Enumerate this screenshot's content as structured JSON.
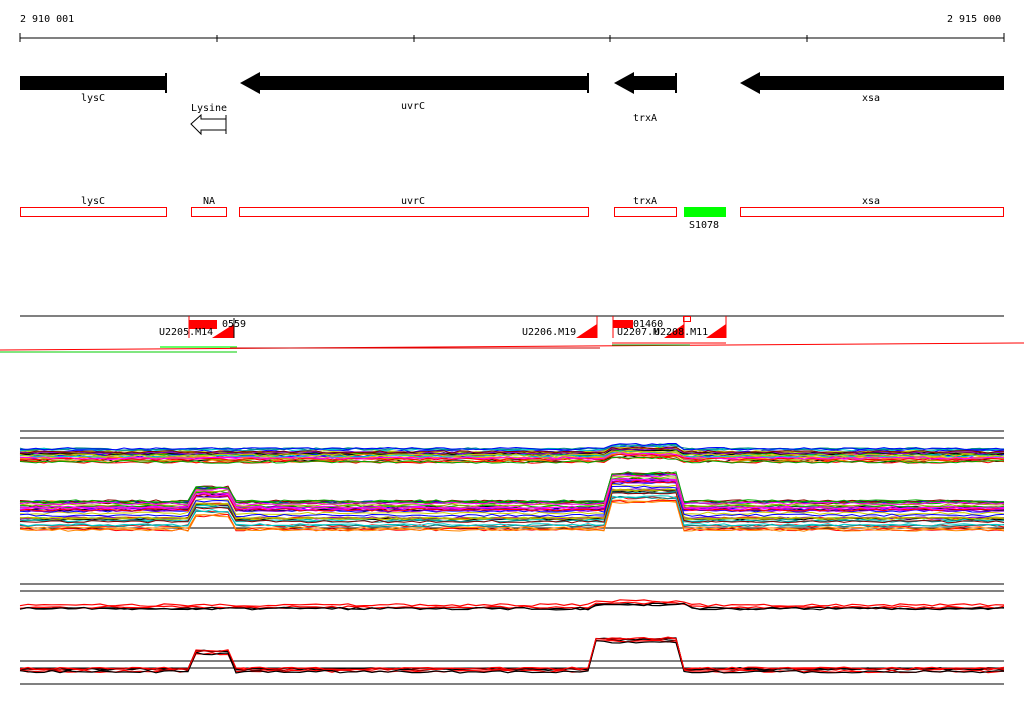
{
  "ruler": {
    "start_label": "2 910 001",
    "end_label": "2 915 000"
  },
  "genes": [
    {
      "name": "lysC"
    },
    {
      "name": "uvrC"
    },
    {
      "name": "trxA"
    },
    {
      "name": "xsa"
    }
  ],
  "riboswitch": {
    "name": "Lysine"
  },
  "features": [
    {
      "name": "lysC"
    },
    {
      "name": "NA"
    },
    {
      "name": "uvrC"
    },
    {
      "name": "trxA"
    },
    {
      "name": "xsa"
    }
  ],
  "green_feature": {
    "name": "S1078",
    "color": "#00ff00"
  },
  "tu_labels": [
    {
      "name": "U2205.M14"
    },
    {
      "name": "U2206.M19"
    },
    {
      "name": "U2207.M"
    },
    {
      "name": "U2208.M11"
    },
    {
      "name": "0559"
    },
    {
      "name": "01460"
    }
  ],
  "colors": {
    "gene": "#000000",
    "feature_border": "#ff0000",
    "tu_box": "#ff0000",
    "green": "#00ff00"
  }
}
